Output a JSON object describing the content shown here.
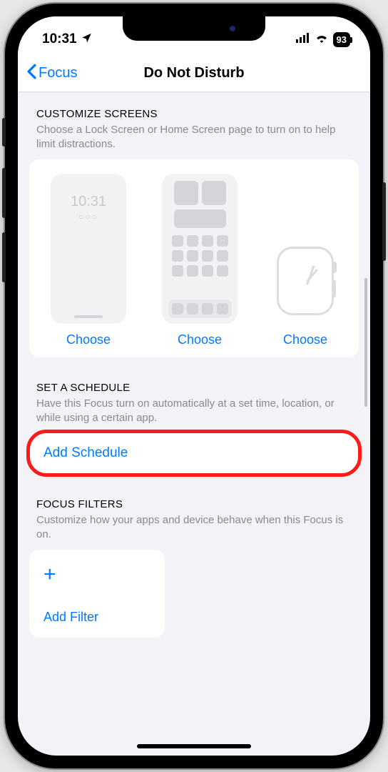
{
  "status": {
    "time": "10:31",
    "battery": "93"
  },
  "nav": {
    "back_label": "Focus",
    "title": "Do Not Disturb"
  },
  "customize": {
    "header": "CUSTOMIZE SCREENS",
    "desc": "Choose a Lock Screen or Home Screen page to turn on to help limit distractions.",
    "lock_time": "10:31",
    "lock_dots": "○○○",
    "choose_lock": "Choose",
    "choose_home": "Choose",
    "choose_watch": "Choose"
  },
  "schedule": {
    "header": "SET A SCHEDULE",
    "desc": "Have this Focus turn on automatically at a set time, location, or while using a certain app.",
    "add_label": "Add Schedule"
  },
  "filters": {
    "header": "FOCUS FILTERS",
    "desc": "Customize how your apps and device behave when this Focus is on.",
    "add_label": "Add Filter"
  }
}
